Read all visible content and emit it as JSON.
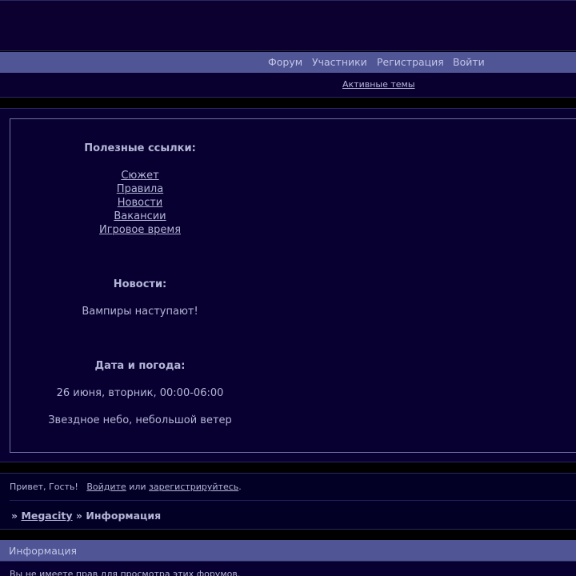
{
  "nav": {
    "items": [
      {
        "label": "Форум"
      },
      {
        "label": "Участники"
      },
      {
        "label": "Регистрация"
      },
      {
        "label": "Войти"
      }
    ],
    "active_topics": "Активные темы"
  },
  "sidebar": {
    "links_title": "Полезные ссылки:",
    "links": [
      "Сюжет",
      "Правила",
      "Новости",
      "Вакансии",
      "Игровое время"
    ],
    "news_title": "Новости:",
    "news_text": "Вампиры наступают!",
    "date_title": "Дата и погода:",
    "date_text": "26 июня, вторник, 00:00-06:00",
    "weather_text": "Звездное небо, небольшой ветер"
  },
  "greeting": {
    "prefix": "Привет, Гость!",
    "login_link": "Войдите",
    "or_text": "или",
    "register_link": "зарегистрируйтесь",
    "suffix": "."
  },
  "breadcrumb": {
    "separator": "»",
    "home": "Megacity",
    "current": "Информация"
  },
  "info": {
    "title": "Информация",
    "message": "Вы не имеете прав для просмотра этих форумов."
  }
}
